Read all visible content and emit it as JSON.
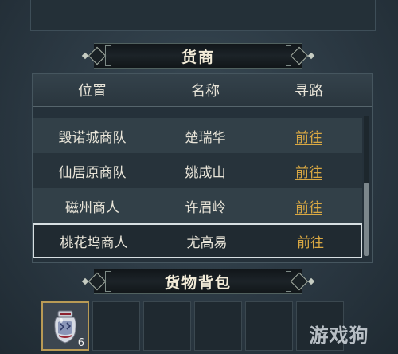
{
  "merchant_section": {
    "title": "货商"
  },
  "table": {
    "headers": [
      "位置",
      "名称",
      "寻路"
    ],
    "rows": [
      {
        "location": "毁诺城商队",
        "name": "楚瑞华",
        "action": "前往"
      },
      {
        "location": "仙居原商队",
        "name": "姚成山",
        "action": "前往"
      },
      {
        "location": "磁州商人",
        "name": "许眉岭",
        "action": "前往"
      },
      {
        "location": "桃花坞商人",
        "name": "尤高易",
        "action": "前往"
      }
    ],
    "selected_row": 3
  },
  "inventory_section": {
    "title": "货物背包",
    "slots": [
      {
        "item": "jar-icon",
        "count": "6"
      },
      {
        "item": null
      },
      {
        "item": null
      },
      {
        "item": null
      },
      {
        "item": null
      },
      {
        "item": null
      }
    ]
  },
  "watermark": {
    "text": "游戏狗"
  },
  "colors": {
    "link": "#d9a843",
    "panel": "#25313a",
    "selected_border": "#d7dfe2"
  }
}
